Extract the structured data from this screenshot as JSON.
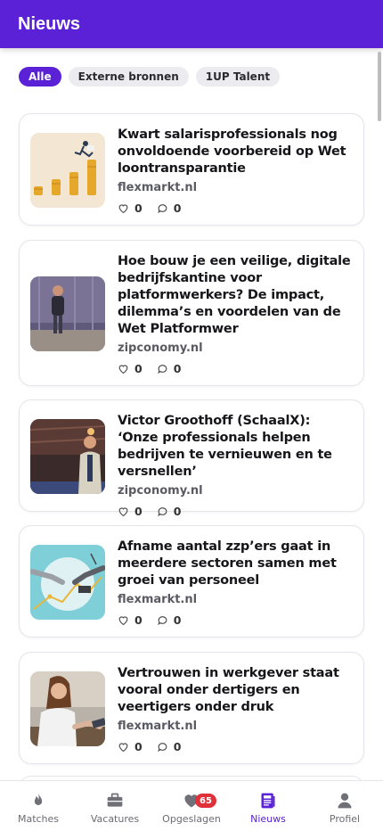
{
  "header": {
    "title": "Nieuws"
  },
  "filters": [
    {
      "label": "Alle",
      "active": true
    },
    {
      "label": "Externe bronnen",
      "active": false
    },
    {
      "label": "1UP Talent",
      "active": false
    }
  ],
  "articles": [
    {
      "title": "Kwart salarisprofessionals nog onvoldoende voorbereid op Wet loontransparantie",
      "source": "flexmarkt.nl",
      "likes": "0",
      "comments": "0",
      "image": "coins-stairs-illustration"
    },
    {
      "title": "Hoe bouw je een veilige, digitale bedrijfskantine voor platformwerkers? De impact, dilemma’s en voordelen van de Wet Platformwer",
      "source": "zipconomy.nl",
      "likes": "0",
      "comments": "0",
      "image": "speaker-on-stage-photo"
    },
    {
      "title": "Victor Groothoff (SchaalX): ‘Onze professionals helpen bedrijven te vernieuwen en te versnellen’",
      "source": "zipconomy.nl",
      "likes": "0",
      "comments": "0",
      "image": "man-portrait-photo"
    },
    {
      "title": "Afname aantal zzp’ers gaat in meerdere sectoren samen met groei van personeel",
      "source": "flexmarkt.nl",
      "likes": "0",
      "comments": "0",
      "image": "hands-chart-illustration"
    },
    {
      "title": "Vertrouwen in werkgever staat vooral onder dertigers en veertigers onder druk",
      "source": "flexmarkt.nl",
      "likes": "0",
      "comments": "0",
      "image": "businesswoman-handshake-photo"
    }
  ],
  "tabbar": [
    {
      "label": "Matches",
      "icon": "flame-icon",
      "active": false
    },
    {
      "label": "Vacatures",
      "icon": "briefcase-icon",
      "active": false
    },
    {
      "label": "Opgeslagen",
      "icon": "heart-icon",
      "active": false,
      "badge": "65"
    },
    {
      "label": "Nieuws",
      "icon": "newspaper-icon",
      "active": true
    },
    {
      "label": "Profiel",
      "icon": "person-icon",
      "active": false
    }
  ],
  "colors": {
    "accent": "#5b21d6",
    "badge": "#e0313a"
  }
}
